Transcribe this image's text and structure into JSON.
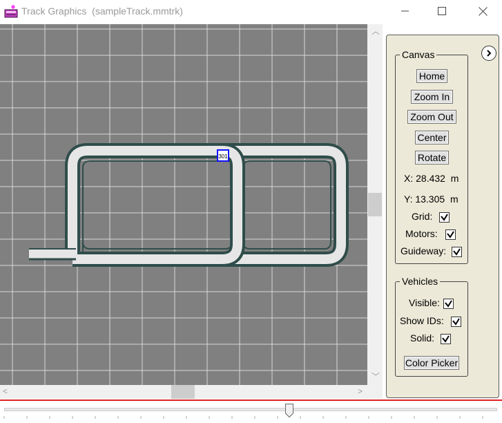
{
  "window": {
    "title": "Track Graphics  (sampleTrack.mmtrk)"
  },
  "track": {
    "selected_id": "301",
    "colors": {
      "grid_bg": "#808080",
      "grid_line": "#d9d9d9",
      "rail": "#2f4d4a",
      "track_fill": "#e6e6e6",
      "selection": "#1010ff"
    }
  },
  "canvas_panel": {
    "title": "Canvas",
    "buttons": {
      "home": "Home",
      "zoom_in": "Zoom In",
      "zoom_out": "Zoom Out",
      "center": "Center",
      "rotate": "Rotate"
    },
    "x_readout": "X: 28.432  m",
    "y_readout": "Y: 13.305  m",
    "grid_label": "Grid:",
    "motors_label": "Motors:",
    "guideway_label": "Guideway:",
    "grid_checked": true,
    "motors_checked": true,
    "guideway_checked": true
  },
  "vehicles_panel": {
    "title": "Vehicles",
    "visible_label": "Visible:",
    "show_ids_label": "Show IDs:",
    "solid_label": "Solid:",
    "visible_checked": true,
    "show_ids_checked": true,
    "solid_checked": true,
    "color_picker": "Color Picker"
  },
  "timeline": {
    "position": 0.58
  }
}
